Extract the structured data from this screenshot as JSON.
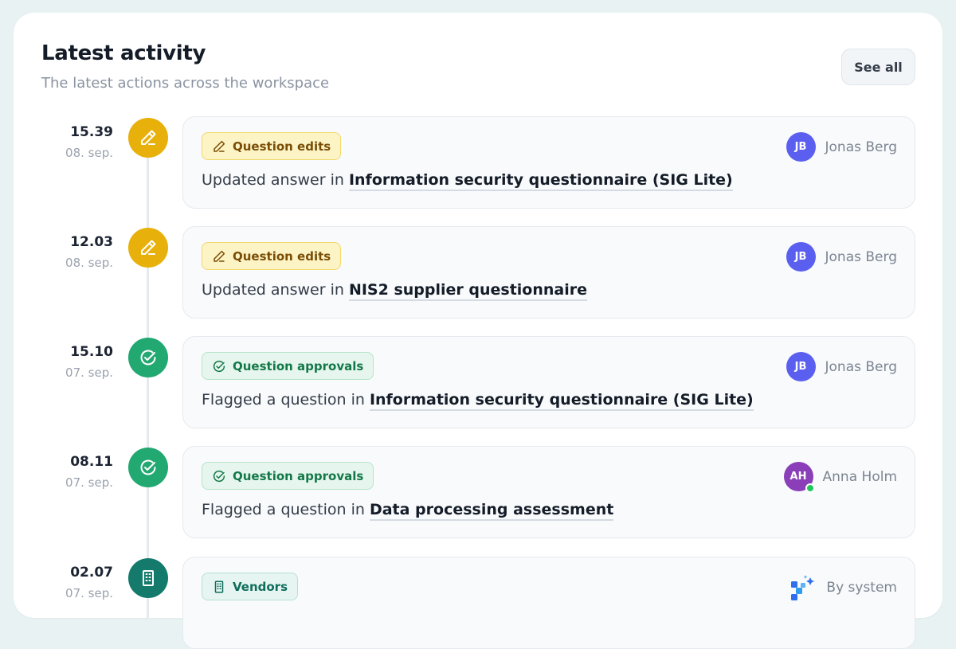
{
  "header": {
    "title": "Latest activity",
    "subtitle": "The latest actions across the workspace",
    "see_all_label": "See all"
  },
  "colors": {
    "edits": "#e8b00a",
    "approvals": "#22a871",
    "vendors": "#137a6c",
    "avatar_jb": "#5b5ff0",
    "avatar_ah": "#8a3fb8"
  },
  "activities": [
    {
      "time": "15.39",
      "date": "08. sep.",
      "icon": "pencil-icon",
      "tag": "Question edits",
      "action": "Updated answer in",
      "target": "Information security questionnaire (SIG Lite)",
      "actor": {
        "initials": "JB",
        "name": "Jonas Berg"
      }
    },
    {
      "time": "12.03",
      "date": "08. sep.",
      "icon": "pencil-icon",
      "tag": "Question edits",
      "action": "Updated answer in",
      "target": "NIS2 supplier questionnaire",
      "actor": {
        "initials": "JB",
        "name": "Jonas Berg"
      }
    },
    {
      "time": "15.10",
      "date": "07. sep.",
      "icon": "check-circle-icon",
      "tag": "Question approvals",
      "action": "Flagged a question in",
      "target": "Information security questionnaire (SIG Lite)",
      "actor": {
        "initials": "JB",
        "name": "Jonas Berg"
      }
    },
    {
      "time": "08.11",
      "date": "07. sep.",
      "icon": "check-circle-icon",
      "tag": "Question approvals",
      "action": "Flagged a question in",
      "target": "Data processing assessment",
      "actor": {
        "initials": "AH",
        "name": "Anna Holm",
        "online": true
      }
    },
    {
      "time": "02.07",
      "date": "07. sep.",
      "icon": "building-icon",
      "tag": "Vendors",
      "actor": {
        "name": "By system",
        "icon": "system-sparkle-icon"
      }
    }
  ]
}
